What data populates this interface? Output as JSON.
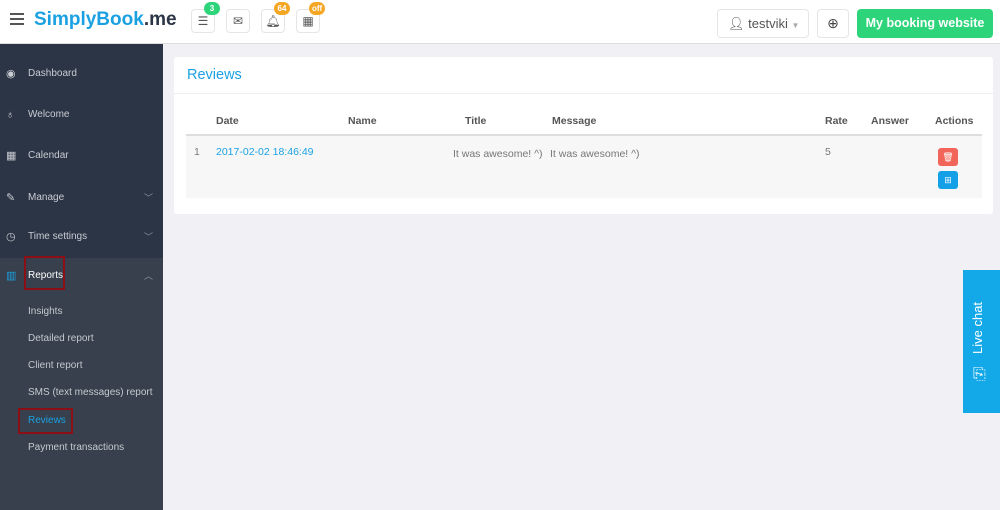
{
  "header": {
    "logo_brand": "SimplyBook",
    "logo_tld": ".me",
    "badges": {
      "tasks": "3",
      "notifications": "64",
      "calendar": "off"
    },
    "user": "testviki",
    "booking_button": "My booking website"
  },
  "sidebar": {
    "items": [
      {
        "label": "Dashboard"
      },
      {
        "label": "Welcome"
      },
      {
        "label": "Calendar"
      },
      {
        "label": "Manage"
      },
      {
        "label": "Time settings"
      },
      {
        "label": "Reports"
      }
    ],
    "reports_sub": [
      "Insights",
      "Detailed report",
      "Client report",
      "SMS (text messages) report",
      "Reviews",
      "Payment transactions"
    ]
  },
  "main": {
    "title": "Reviews",
    "columns": [
      "Date",
      "Name",
      "Title",
      "Message",
      "Rate",
      "Answer",
      "Actions"
    ],
    "rows": [
      {
        "num": "1",
        "date": "2017-02-02 18:46:49",
        "name": "",
        "title": "It was awesome! ^)",
        "message": "It was awesome! ^)",
        "rate": "5",
        "answer": ""
      }
    ]
  },
  "live_chat": "Live chat",
  "colors": {
    "accent": "#1ba1e2",
    "green": "#2ed47a",
    "sidebar": "#2c3545",
    "delete": "#f2655a",
    "highlight": "#8b0f14"
  }
}
